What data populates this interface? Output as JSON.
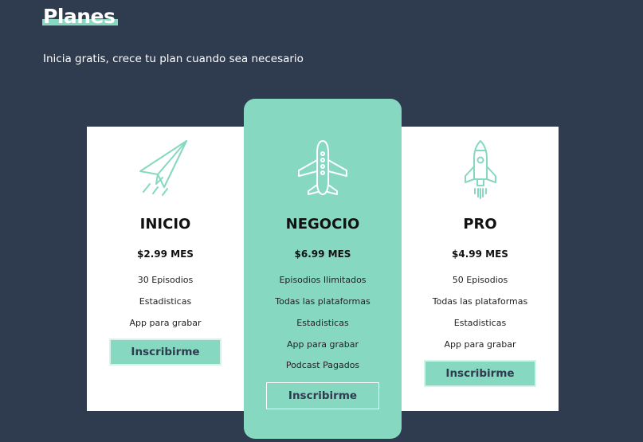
{
  "header": {
    "title": "Planes",
    "subtitle": "Inicia gratis, crece tu plan cuando sea necesario"
  },
  "colors": {
    "background": "#2f3b4e",
    "accent": "#86d9c0",
    "card": "#ffffff"
  },
  "plans": [
    {
      "name": "INICIO",
      "price": "$2.99 MES",
      "icon": "paper-plane-icon",
      "features": [
        "30 Episodios",
        "Estadisticas",
        "App para grabar"
      ],
      "button_label": "Inscribirme"
    },
    {
      "name": "NEGOCIO",
      "price": "$6.99 MES",
      "icon": "airplane-icon",
      "features": [
        "Episodios Ilimitados",
        "Todas las plataformas",
        "Estadisticas",
        "App para grabar",
        "Podcast Pagados"
      ],
      "button_label": "Inscribirme"
    },
    {
      "name": "PRO",
      "price": "$4.99 MES",
      "icon": "rocket-icon",
      "features": [
        "50 Episodios",
        "Todas las plataformas",
        "Estadisticas",
        "App para grabar"
      ],
      "button_label": "Inscribirme"
    }
  ]
}
